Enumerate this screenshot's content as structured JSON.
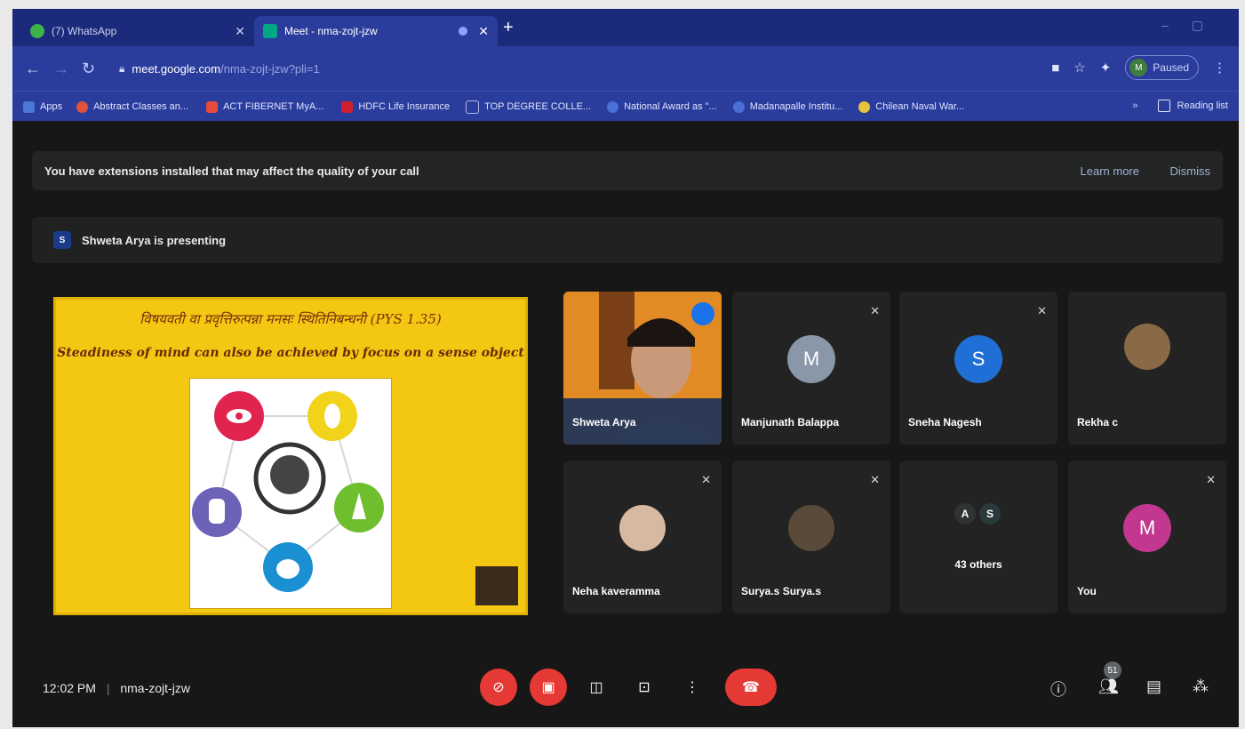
{
  "browser": {
    "tabs": [
      {
        "label": "(7) WhatsApp",
        "active": false
      },
      {
        "label": "Meet - nma-zojt-jzw",
        "active": true
      }
    ],
    "address": {
      "host": "meet.google.com",
      "path": "/nma-zojt-jzw?pli=1"
    },
    "profile": {
      "initials": "M",
      "status": "Paused"
    },
    "bookmarks": [
      {
        "label": "Apps",
        "color": "#4a79d6"
      },
      {
        "label": "Abstract Classes an...",
        "color": "#e2523a"
      },
      {
        "label": "ACT FIBERNET MyA...",
        "color": "#e64b3b"
      },
      {
        "label": "HDFC Life Insurance",
        "color": "#d0202f"
      },
      {
        "label": "TOP DEGREE COLLE...",
        "color": "#b0b7e8"
      },
      {
        "label": "National Award as \"...",
        "color": "#4a6fd8"
      },
      {
        "label": "Madanapalle Institu...",
        "color": "#4a6fd8"
      },
      {
        "label": "Chilean Naval War...",
        "color": "#e8c23a"
      }
    ],
    "reading_list": "Reading list"
  },
  "meet": {
    "banner": {
      "message": "You have extensions installed that may affect the quality of your call",
      "learn_more": "Learn more",
      "dismiss": "Dismiss"
    },
    "presenter": {
      "initial": "S",
      "text": "Shweta Arya is presenting"
    },
    "slide": {
      "sanskrit": "विषयवती वा प्रवृत्तिरुत्पन्ना मनसः स्थितिनिबन्धनी    (PYS 1.35)",
      "english": "Steadiness of mind can also be achieved by focus on a sense object"
    },
    "participants": [
      {
        "name": "Shweta Arya",
        "type": "video",
        "speaking": true
      },
      {
        "name": "Manjunath Balappa",
        "initial": "M",
        "color": "#8a97a8",
        "muted": true
      },
      {
        "name": "Sneha Nagesh",
        "initial": "S",
        "color": "#1f6fd6",
        "muted": true
      },
      {
        "name": "Rekha c",
        "type": "photo",
        "muted": false
      },
      {
        "name": "Neha kaveramma",
        "type": "photo",
        "muted": true
      },
      {
        "name": "Surya.s Surya.s",
        "type": "photo",
        "muted": true
      },
      {
        "name": "43 others",
        "initials": [
          "A",
          "S"
        ],
        "muted": false
      },
      {
        "name": "You",
        "initial": "M",
        "color": "#c2378f",
        "muted": true
      }
    ],
    "time": "12:02 PM",
    "meeting_code": "nma-zojt-jzw",
    "participant_count": "51"
  }
}
